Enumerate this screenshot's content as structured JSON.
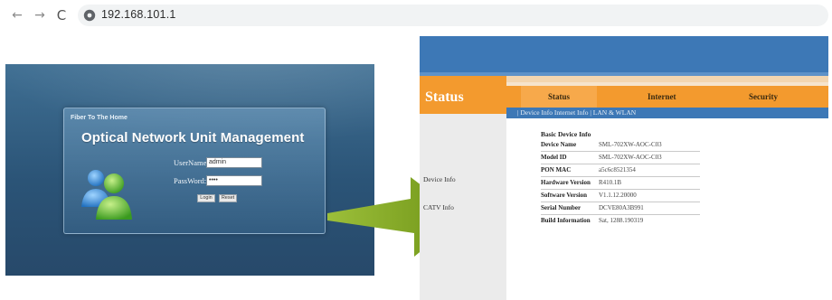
{
  "browser": {
    "back_icon": "arrow-left-icon",
    "forward_icon": "arrow-right-icon",
    "reload_icon": "reload-icon",
    "url": "192.168.101.1"
  },
  "login_screen": {
    "header_small": "Fiber To The Home",
    "title": "Optical Network Unit Management",
    "username_label": "UserName:",
    "password_label": "PassWord:",
    "username_value": "admin",
    "password_value": "••••",
    "login_button": "Login",
    "reset_button": "Reset",
    "icon": "users-icon"
  },
  "status_screen": {
    "logo": "Status",
    "tabs": [
      {
        "label": "Status"
      },
      {
        "label": "Internet"
      },
      {
        "label": "Security"
      }
    ],
    "subnav": "|  Device Info    Internet Info  |    LAN & WLAN",
    "sidebar": [
      {
        "label": "Device Info"
      },
      {
        "label": "CATV Info"
      }
    ],
    "section_title": "Basic Device Info",
    "rows": [
      {
        "key": "Device Name",
        "value": "SML-702XW-AOC-C03"
      },
      {
        "key": "Model ID",
        "value": "SML-702XW-AOC-C03"
      },
      {
        "key": "PON MAC",
        "value": "a5c6c8521354"
      },
      {
        "key": "Hardware Version",
        "value": "R410.1B"
      },
      {
        "key": "Software Version",
        "value": "V1.1.12.20000"
      },
      {
        "key": "Serial Number",
        "value": "DCVE80A3B991"
      },
      {
        "key": "Build Information",
        "value": "Sat, 1288.190319"
      }
    ]
  },
  "colors": {
    "accent_orange": "#f39a2e",
    "header_blue": "#3d78b6",
    "arrow_green": "#7fa21e",
    "login_bg": "#2f5a7e"
  }
}
